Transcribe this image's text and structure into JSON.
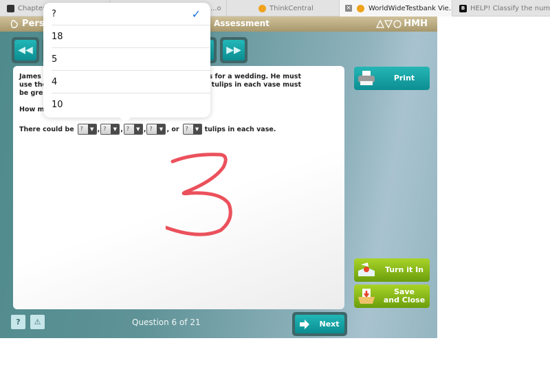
{
  "browser": {
    "tabs": [
      {
        "label": "Chapter",
        "icon": "profile-square-icon",
        "active": false
      },
      {
        "label": "...o",
        "icon": "",
        "active": false
      },
      {
        "label": "ThinkCentral",
        "icon": "orange-dot-icon",
        "active": false
      },
      {
        "label": "WorldWideTestbank Vie...",
        "icon": "orange-dot-icon",
        "active": true
      },
      {
        "label": "HELP! Classify the num",
        "icon": "brainly-icon",
        "active": false
      }
    ]
  },
  "header": {
    "brand": "Pers",
    "title": "Assessment",
    "publisher": "HMH"
  },
  "question": {
    "paragraph1": "James w... ...ses for a wedding. He must use the... ...r of tulips in each vase must be grea...",
    "line1_visible_left": "James w",
    "line1_visible_right": "ses for a wedding. He must",
    "line2_visible_left": "use the",
    "line2_visible_right": "r of tulips in each vase must",
    "line3_visible_left": "be grea",
    "prompt_visible_left": "How m",
    "answer_prefix": "There could be",
    "answer_sep1": ",",
    "answer_sep2": ",",
    "answer_sep3": ",",
    "answer_or": ", or",
    "answer_suffix": "tulips in each vase.",
    "selects": [
      "?",
      "?",
      "?",
      "?",
      "?"
    ],
    "handwritten_answer": "3"
  },
  "dropdown": {
    "options": [
      {
        "label": "?",
        "selected": true
      },
      {
        "label": "18",
        "selected": false
      },
      {
        "label": "5",
        "selected": false
      },
      {
        "label": "4",
        "selected": false
      },
      {
        "label": "10",
        "selected": false
      }
    ],
    "check_glyph": "✓"
  },
  "sidebar": {
    "print_label": "Print",
    "turn_in_label": "Turn it In",
    "save_label_line1": "Save",
    "save_label_line2": "and Close"
  },
  "footer": {
    "help_glyph": "?",
    "alert_glyph": "⚠",
    "counter": "Question 6 of 21",
    "next_label": "Next"
  },
  "colors": {
    "teal_button": "#0c8e92",
    "green_button": "#7aab12",
    "header_gold": "#b9a97c",
    "check_blue": "#1a73d9",
    "scribble_red": "#e8323f"
  }
}
